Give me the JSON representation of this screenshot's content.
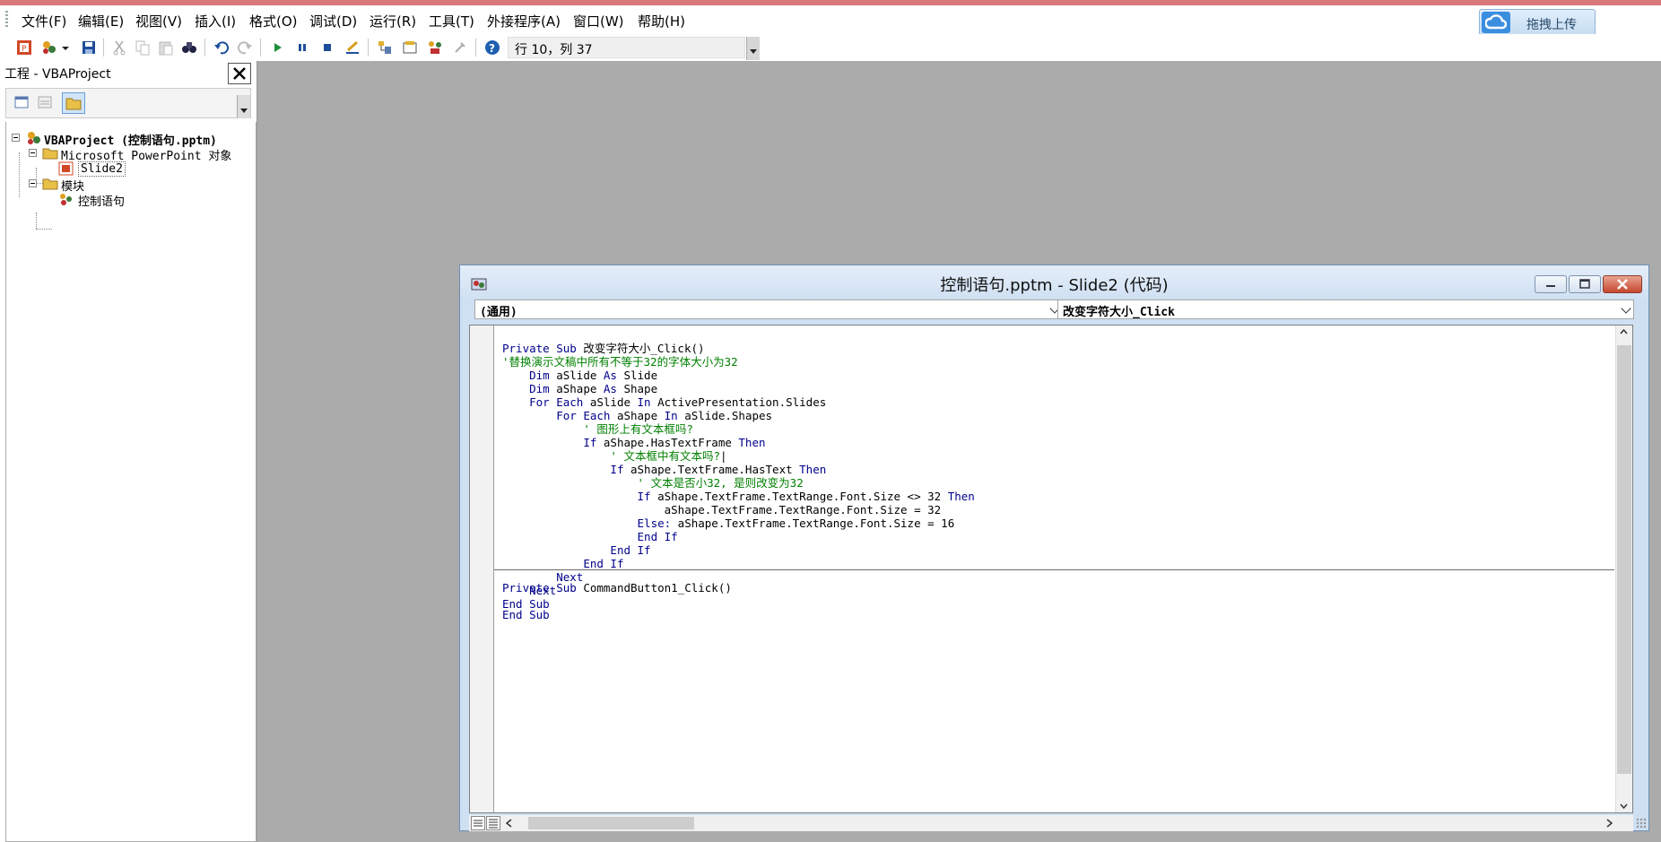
{
  "menu": {
    "items": [
      {
        "label": "文件(F)"
      },
      {
        "label": "编辑(E)"
      },
      {
        "label": "视图(V)"
      },
      {
        "label": "插入(I)"
      },
      {
        "label": "格式(O)"
      },
      {
        "label": "调试(D)"
      },
      {
        "label": "运行(R)"
      },
      {
        "label": "工具(T)"
      },
      {
        "label": "外接程序(A)"
      },
      {
        "label": "窗口(W)"
      },
      {
        "label": "帮助(H)"
      }
    ]
  },
  "upload": {
    "label": "拖拽上传"
  },
  "toolbar": {
    "position": "行 10，列 37"
  },
  "project": {
    "title": "工程 - VBAProject",
    "tree": {
      "root": "VBAProject (控制语句.pptm)",
      "objects_folder": "Microsoft PowerPoint 对象",
      "slide": "Slide2",
      "modules_folder": "模块",
      "module": "控制语句"
    }
  },
  "code_window": {
    "title": "控制语句.pptm - Slide2 (代码)",
    "object_combo": "(通用)",
    "procedure_combo": "改变字符大小_Click",
    "procedure1": [
      [
        {
          "k": "Private Sub "
        },
        {
          "t": "改变字符大小_Click()"
        }
      ],
      [
        {
          "c": "'替换演示文稿中所有不等于32的字体大小为32"
        }
      ],
      [
        {
          "t": "    "
        },
        {
          "k": "Dim "
        },
        {
          "t": "aSlide "
        },
        {
          "k": "As "
        },
        {
          "t": "Slide"
        }
      ],
      [
        {
          "t": "    "
        },
        {
          "k": "Dim "
        },
        {
          "t": "aShape "
        },
        {
          "k": "As "
        },
        {
          "t": "Shape"
        }
      ],
      [
        {
          "t": "    "
        },
        {
          "k": "For Each "
        },
        {
          "t": "aSlide "
        },
        {
          "k": "In "
        },
        {
          "t": "ActivePresentation.Slides"
        }
      ],
      [
        {
          "t": "        "
        },
        {
          "k": "For Each "
        },
        {
          "t": "aShape "
        },
        {
          "k": "In "
        },
        {
          "t": "aSlide.Shapes"
        }
      ],
      [
        {
          "t": "            "
        },
        {
          "c": "' 图形上有文本框吗?"
        }
      ],
      [
        {
          "t": "            "
        },
        {
          "k": "If "
        },
        {
          "t": "aShape.HasTextFrame "
        },
        {
          "k": "Then"
        }
      ],
      [
        {
          "t": "                "
        },
        {
          "c": "' 文本框中有文本吗?"
        },
        {
          "t": "|"
        }
      ],
      [
        {
          "t": "                "
        },
        {
          "k": "If "
        },
        {
          "t": "aShape.TextFrame.HasText "
        },
        {
          "k": "Then"
        }
      ],
      [
        {
          "t": "                    "
        },
        {
          "c": "' 文本是否小32, 是则改变为32"
        }
      ],
      [
        {
          "t": "                    "
        },
        {
          "k": "If "
        },
        {
          "t": "aShape.TextFrame.TextRange.Font.Size <> 32 "
        },
        {
          "k": "Then"
        }
      ],
      [
        {
          "t": "                        aShape.TextFrame.TextRange.Font.Size = 32"
        }
      ],
      [
        {
          "t": "                    "
        },
        {
          "k": "Else: "
        },
        {
          "t": "aShape.TextFrame.TextRange.Font.Size = 16"
        }
      ],
      [
        {
          "t": "                    "
        },
        {
          "k": "End If"
        }
      ],
      [
        {
          "t": "                "
        },
        {
          "k": "End If"
        }
      ],
      [
        {
          "t": "            "
        },
        {
          "k": "End If"
        }
      ],
      [
        {
          "t": "        "
        },
        {
          "k": "Next"
        }
      ],
      [
        {
          "t": "    "
        },
        {
          "k": "Next"
        }
      ],
      [
        {
          "k": "End Sub"
        }
      ]
    ],
    "procedure2": [
      [
        {
          "k": "Private Sub "
        },
        {
          "t": "CommandButton1_Click()"
        }
      ],
      [
        {
          "t": ""
        }
      ],
      [
        {
          "k": "End Sub"
        }
      ]
    ]
  },
  "colors": {
    "keyword": "#00008b",
    "comment": "#008000",
    "background": "#ababab"
  }
}
